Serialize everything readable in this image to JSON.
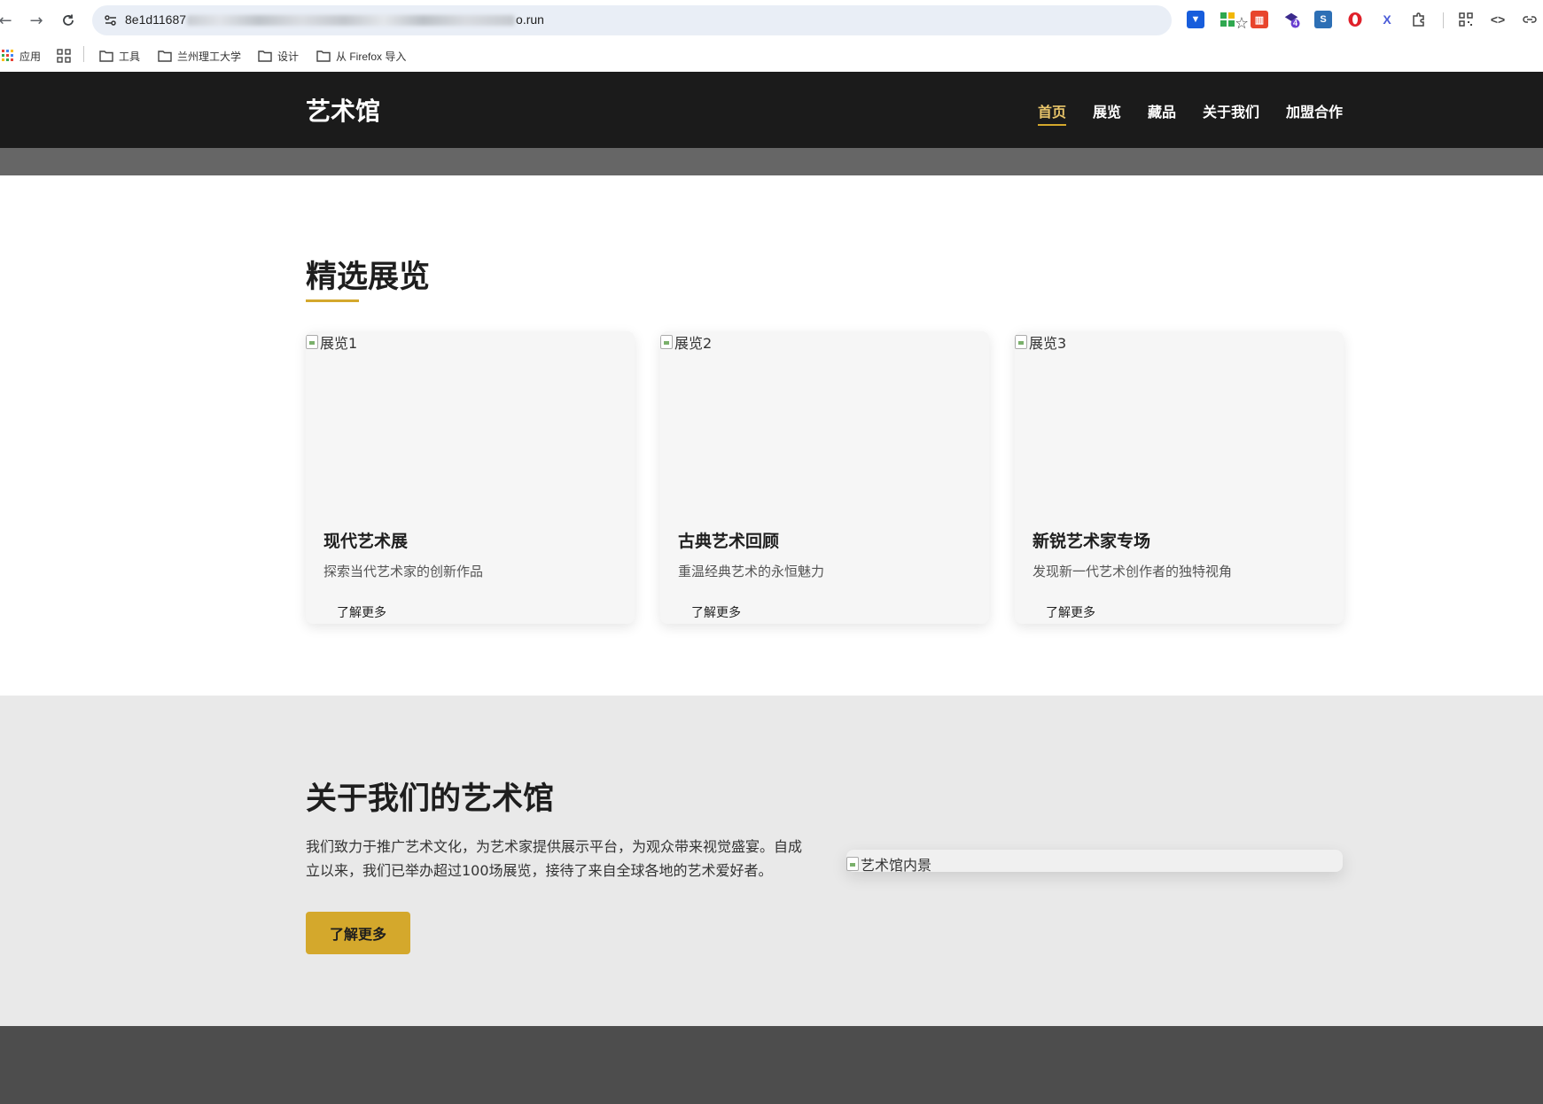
{
  "browser": {
    "url_prefix": "8e1d11687",
    "url_suffix": "o.run",
    "bookmarks": [
      "应用",
      "工具",
      "兰州理工大学",
      "设计",
      "从 Firefox 导入"
    ],
    "extension_badge": "4"
  },
  "site": {
    "logo": "艺术馆",
    "nav": [
      "首页",
      "展览",
      "藏品",
      "关于我们",
      "加盟合作"
    ],
    "active_nav": "首页",
    "accent_color": "#d4a82c"
  },
  "featured": {
    "title": "精选展览",
    "cards": [
      {
        "img_alt": "展览1",
        "title": "现代艺术展",
        "desc": "探索当代艺术家的创新作品",
        "link": "了解更多"
      },
      {
        "img_alt": "展览2",
        "title": "古典艺术回顾",
        "desc": "重温经典艺术的永恒魅力",
        "link": "了解更多"
      },
      {
        "img_alt": "展览3",
        "title": "新锐艺术家专场",
        "desc": "发现新一代艺术创作者的独特视角",
        "link": "了解更多"
      }
    ]
  },
  "about": {
    "title": "关于我们的艺术馆",
    "text": "我们致力于推广艺术文化，为艺术家提供展示平台，为观众带来视觉盛宴。自成立以来，我们已举办超过100场展览，接待了来自全球各地的艺术爱好者。",
    "button": "了解更多",
    "img_alt": "艺术馆内景"
  }
}
